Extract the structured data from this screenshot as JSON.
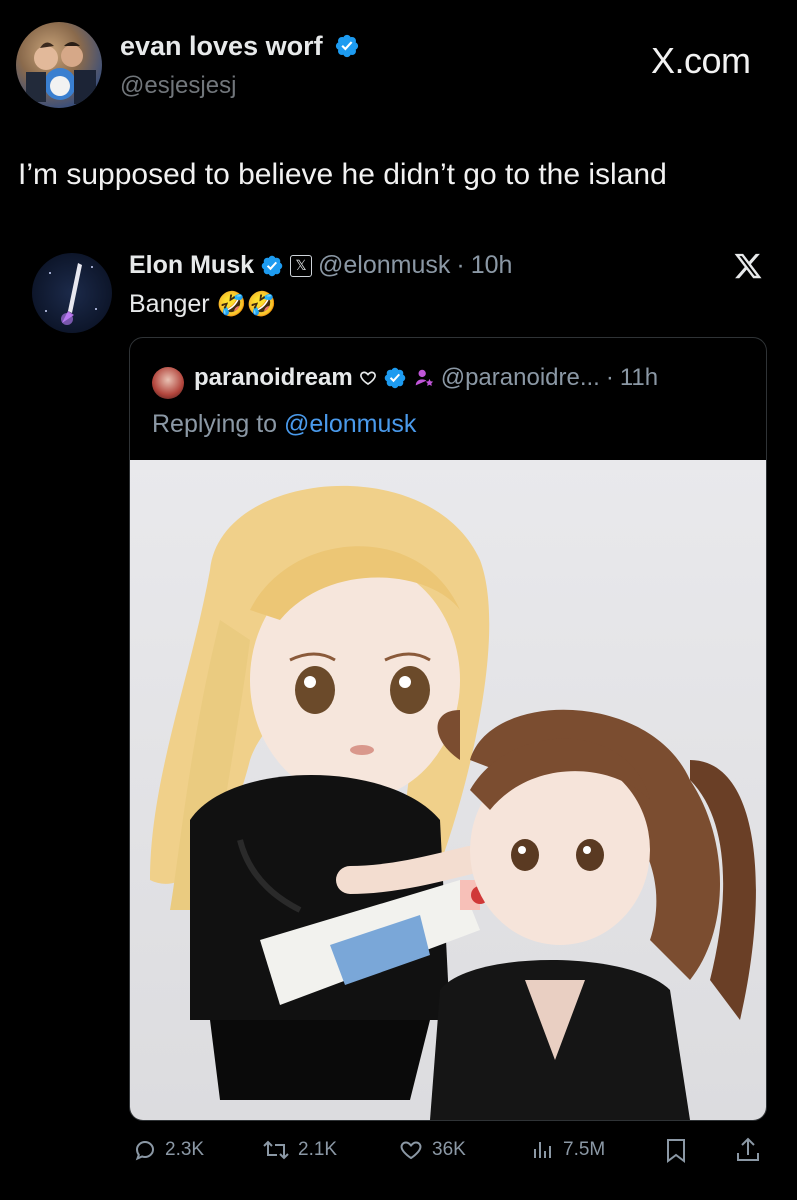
{
  "header": {
    "display_name": "evan loves worf",
    "handle": "@esjesjesj",
    "site_label": "X.com"
  },
  "tweet": {
    "text": "I’m supposed to believe he didn’t go to the island"
  },
  "quoted": {
    "display_name": "Elon Musk",
    "handle": "@elonmusk",
    "dot": "·",
    "time": "10h",
    "text": "Banger",
    "emoji": "🤣🤣"
  },
  "nested": {
    "display_name": "paranoidream",
    "handle": "@paranoidre...",
    "dot": "·",
    "time": "11h",
    "replying_prefix": "Replying to",
    "replying_to": "@elonmusk"
  },
  "actions": {
    "replies": "2.3K",
    "reposts": "2.1K",
    "likes": "36K",
    "views": "7.5M"
  },
  "colors": {
    "background": "#000000",
    "verified": "#1d9bf0",
    "link": "#4a9aeb",
    "muted": "#71767b",
    "border": "#2f3336"
  }
}
